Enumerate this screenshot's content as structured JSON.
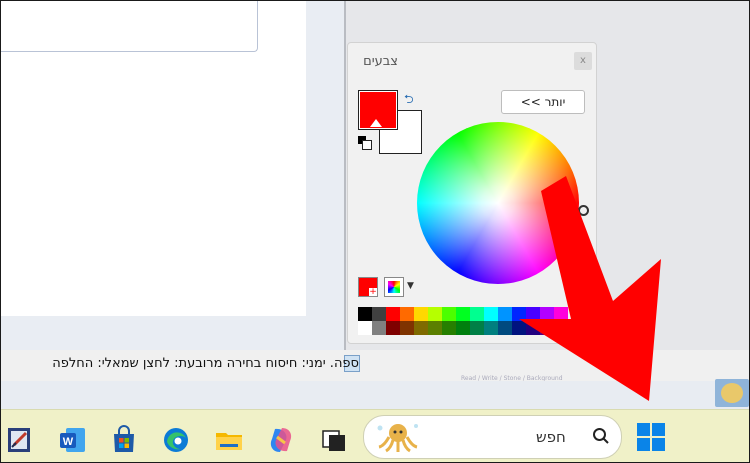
{
  "colors_window": {
    "title": "צבעים",
    "close_label": "x",
    "more_button_label": "יותר >>",
    "primary_color": "#ff0000",
    "secondary_color": "#ffffff",
    "palette_row1": [
      "#000000",
      "#404040",
      "#ff0000",
      "#ff6a00",
      "#ffd800",
      "#b6ff00",
      "#4cff00",
      "#00ff21",
      "#00ff90",
      "#00ffff",
      "#0094ff",
      "#0026ff",
      "#4800ff",
      "#b200ff",
      "#ff00dc"
    ],
    "palette_row2": [
      "#ffffff",
      "#808080",
      "#7f0000",
      "#7f3300",
      "#7f6a00",
      "#5b7f00",
      "#267f00",
      "#007f0e",
      "#007f46",
      "#007f7f",
      "#004a7f",
      "#00137f",
      "#21007f",
      "#57007f",
      "#7f006e"
    ]
  },
  "status_bar": {
    "text": "ספה. ימני: חיסוח        בחירה מרובעת: לחצן שמאלי: החלפה",
    "subtext": "Read / Write / Stone / Background"
  },
  "taskbar": {
    "search_placeholder": "חפש",
    "apps": [
      "paint-app-icon",
      "word-icon",
      "store-icon",
      "edge-icon",
      "file-explorer-icon",
      "copilot-icon",
      "task-view-icon"
    ]
  },
  "annotation_color": "#ff0000"
}
